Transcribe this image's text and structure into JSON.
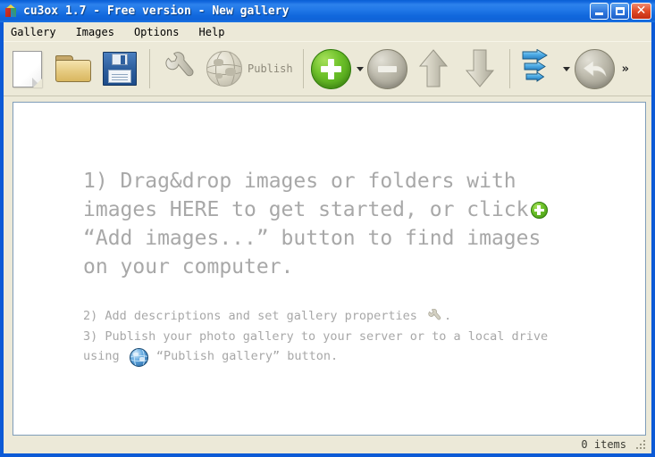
{
  "window": {
    "title": "cu3ox 1.7 - Free version - New gallery",
    "app_icon": "cube-icon",
    "controls": {
      "minimize": "minimize-button",
      "maximize": "maximize-button",
      "close_glyph": "✕"
    }
  },
  "menubar": {
    "items": [
      {
        "label": "Gallery"
      },
      {
        "label": "Images"
      },
      {
        "label": "Options"
      },
      {
        "label": "Help"
      }
    ]
  },
  "toolbar": {
    "buttons": [
      {
        "name": "new-gallery-button",
        "icon": "new-document-icon",
        "label": ""
      },
      {
        "name": "open-gallery-button",
        "icon": "open-folder-icon",
        "label": ""
      },
      {
        "name": "save-gallery-button",
        "icon": "floppy-disk-icon",
        "label": ""
      },
      {
        "name": "gallery-properties-button",
        "icon": "wrench-icon",
        "label": ""
      },
      {
        "name": "publish-gallery-button",
        "icon": "globe-icon",
        "label": "Publish"
      },
      {
        "name": "add-images-button",
        "icon": "green-plus-icon",
        "label": ""
      },
      {
        "name": "remove-images-button",
        "icon": "gray-minus-icon",
        "label": ""
      },
      {
        "name": "move-up-button",
        "icon": "arrow-up-icon",
        "label": ""
      },
      {
        "name": "move-down-button",
        "icon": "arrow-down-icon",
        "label": ""
      },
      {
        "name": "batch-process-button",
        "icon": "blue-arrows-icon",
        "label": ""
      },
      {
        "name": "undo-button",
        "icon": "undo-arrow-icon",
        "label": ""
      }
    ],
    "overflow_label": "»",
    "publish_label": "Publish"
  },
  "content": {
    "hint_big": {
      "line1": "1) Drag&drop images or folders with",
      "line2_a": "images HERE to get started, or click",
      "line3": "“Add images...” button to find images",
      "line4": "on your computer."
    },
    "hint_small": {
      "line2_a": "2) Add descriptions and set gallery properties",
      "line2_b": ".",
      "line3_a": "3) Publish your photo gallery to your server or to a local drive",
      "line3_b": "using",
      "line3_c": "“Publish gallery” button."
    }
  },
  "statusbar": {
    "items_count": "0 items"
  },
  "colors": {
    "titlebar_blue": "#1268de",
    "window_face": "#ece9d8",
    "content_bg": "#ffffff",
    "hint_text": "#a8a8a8",
    "accent_green": "#6fc22b",
    "close_red": "#e04a25"
  }
}
